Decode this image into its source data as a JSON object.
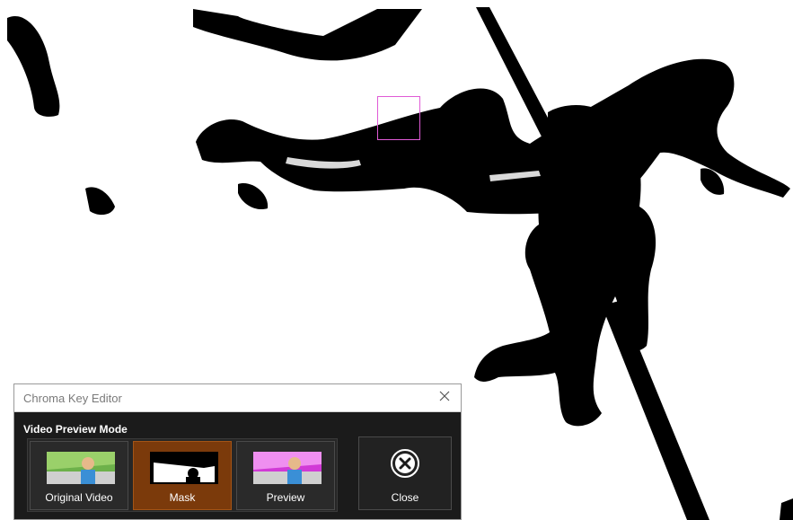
{
  "window": {
    "title": "Chroma Key Editor"
  },
  "section": {
    "label": "Video Preview Mode"
  },
  "modes": [
    {
      "label": "Original Video",
      "active": false
    },
    {
      "label": "Mask",
      "active": true
    },
    {
      "label": "Preview",
      "active": false
    }
  ],
  "close_button": {
    "label": "Close"
  },
  "colors": {
    "accent_active": "#7b3a0b",
    "selection": "#e05bd6",
    "mask_fg": "#000000",
    "mask_bg": "#ffffff",
    "chroma_green": "#4caf50",
    "chroma_magenta": "#d13ad6"
  },
  "icons": {
    "window_close": "close-x-icon",
    "close_circle": "close-circle-icon"
  }
}
